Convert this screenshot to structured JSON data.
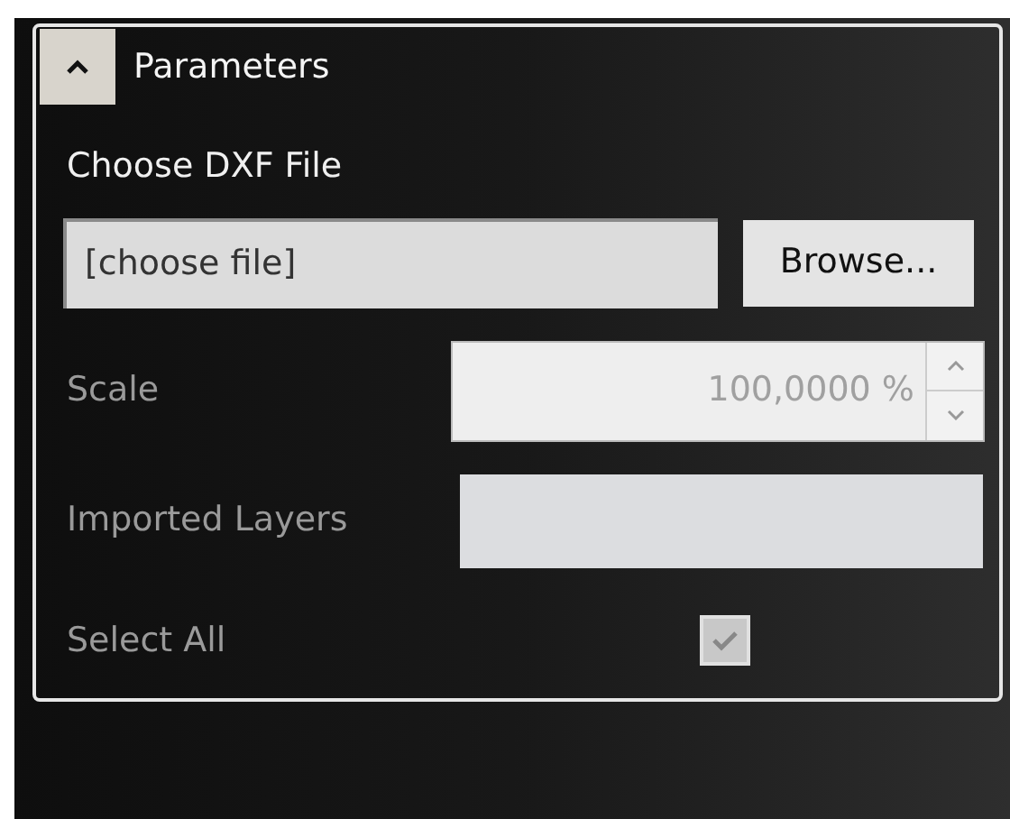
{
  "group": {
    "title": "Parameters",
    "expanded": true
  },
  "file_label": "Choose DXF File",
  "file_field": {
    "value": "[choose file]"
  },
  "browse_button": "Browse...",
  "scale": {
    "label": "Scale",
    "value": "100,0000 %",
    "disabled": true
  },
  "imported_layers": {
    "label": "Imported Layers",
    "disabled": true
  },
  "select_all": {
    "label": "Select All",
    "checked": true,
    "disabled": true
  }
}
